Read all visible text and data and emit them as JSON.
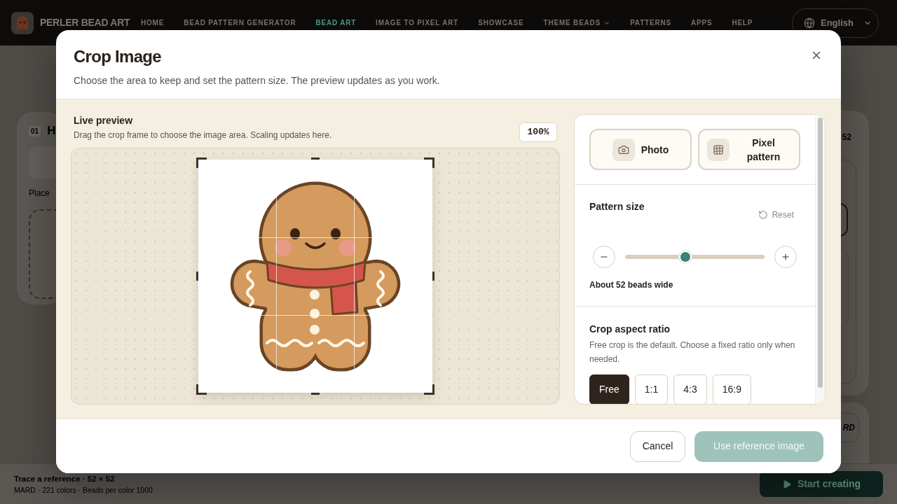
{
  "nav": {
    "brand": "PERLER BEAD ART",
    "items": [
      {
        "label": "HOME",
        "selected": false,
        "kind": "link"
      },
      {
        "label": "BEAD PATTERN GENERATOR",
        "selected": false,
        "kind": "link"
      },
      {
        "label": "BEAD ART",
        "selected": true,
        "kind": "link"
      },
      {
        "label": "IMAGE TO PIXEL ART",
        "selected": false,
        "kind": "link"
      },
      {
        "label": "SHOWCASE",
        "selected": false,
        "kind": "link"
      },
      {
        "label": "THEME BEADS",
        "selected": false,
        "kind": "menu"
      },
      {
        "label": "PATTERNS",
        "selected": false,
        "kind": "link"
      },
      {
        "label": "APPS",
        "selected": false,
        "kind": "link"
      },
      {
        "label": "HELP",
        "selected": false,
        "kind": "link"
      }
    ],
    "language": "English"
  },
  "background": {
    "left_card": {
      "step": "01",
      "title": "H",
      "text": "Place"
    },
    "right_card": {
      "value": "52"
    },
    "lower_card": {
      "text": "RD"
    }
  },
  "bottom_bar": {
    "title": "Trace a reference · 52 × 52",
    "details": "MARD · 221 colors · Beads per color 1000",
    "start_button": "Start creating"
  },
  "dialog": {
    "title": "Crop Image",
    "subtitle": "Choose the area to keep and set the pattern size. The preview updates as you work.",
    "preview": {
      "title": "Live preview",
      "hint": "Drag the crop frame to choose the image area. Scaling updates here.",
      "zoom": "100%"
    },
    "modes": [
      {
        "label": "Photo",
        "kind": "photo"
      },
      {
        "label": "Pixel pattern",
        "kind": "pixel"
      }
    ],
    "pattern_size": {
      "title": "Pattern size",
      "reset": "Reset",
      "level": 0.43,
      "caption": "About 52 beads wide"
    },
    "aspect": {
      "title": "Crop aspect ratio",
      "description": "Free crop is the default. Choose a fixed ratio only when needed.",
      "options": [
        {
          "label": "Free",
          "selected": true
        },
        {
          "label": "1:1",
          "selected": false
        },
        {
          "label": "4:3",
          "selected": false
        },
        {
          "label": "16:9",
          "selected": false
        }
      ]
    },
    "buttons": {
      "cancel": "Cancel",
      "confirm": {
        "label": "Use reference image",
        "disabled": true
      }
    }
  }
}
